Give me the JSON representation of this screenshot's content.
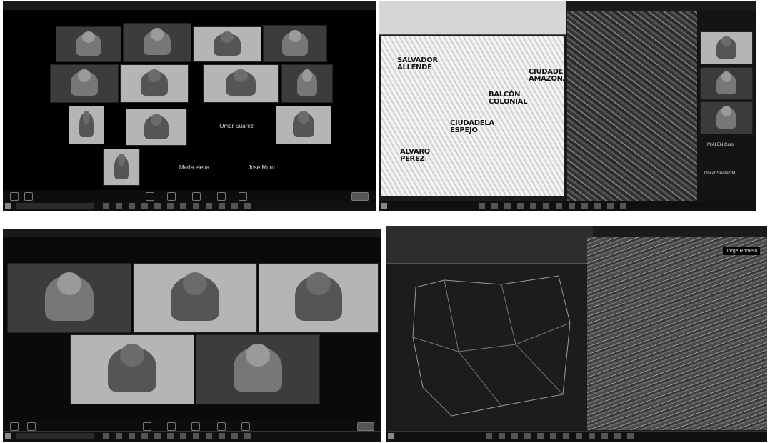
{
  "top_left": {
    "names": {
      "omar": "Omar Suárez",
      "maria": "María elena",
      "jose": "José Muro"
    }
  },
  "top_right": {
    "map_labels": {
      "salvador": "SALVADOR\nALLENDE",
      "ciudadela": "CIUDADELA\nAMAZONAS",
      "balcon": "BALCÓN\nCOLONIAL",
      "ciudadela2": "CIUDADELA\nESPEJO",
      "alvaro": "ALVARO\nPEREZ"
    },
    "side_names": {
      "n1": "MIALEN Carol",
      "n2": "Oscar Suárez M."
    }
  },
  "bottom_right": {
    "presenter": "Jorge Romero"
  }
}
